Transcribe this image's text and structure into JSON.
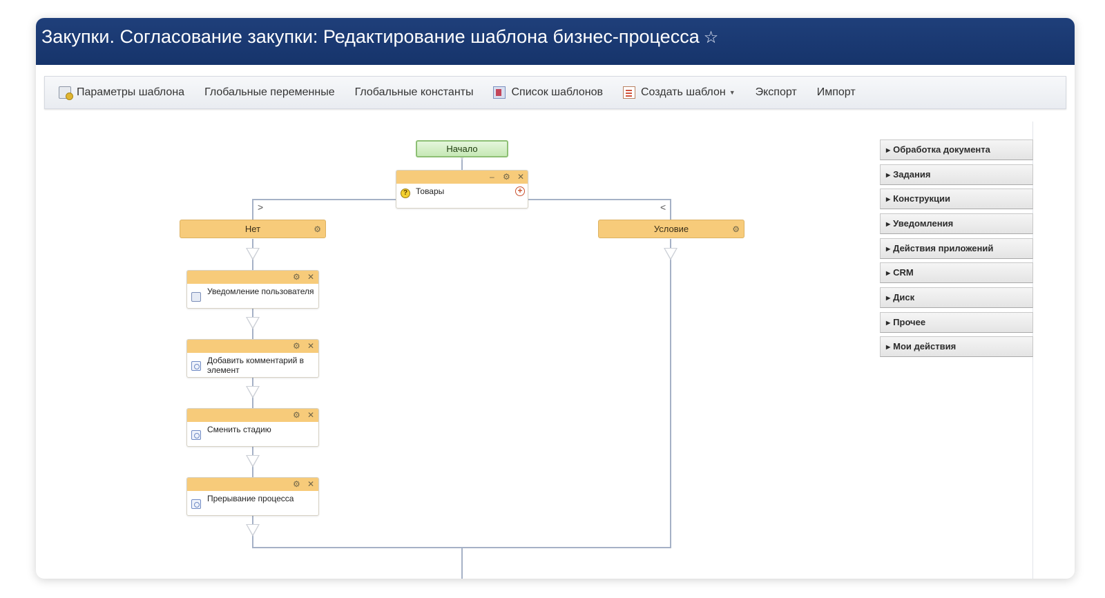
{
  "header": {
    "title": "Закупки. Согласование закупки: Редактирование шаблона бизнес-процесса",
    "star": "☆"
  },
  "toolbar": {
    "items": [
      {
        "label": "Параметры шаблона",
        "icon": "template-params-icon"
      },
      {
        "label": "Глобальные переменные"
      },
      {
        "label": "Глобальные константы"
      },
      {
        "label": "Список шаблонов",
        "icon": "template-list-icon"
      },
      {
        "label": "Создать шаблон",
        "icon": "create-template-icon",
        "dropdown": true
      },
      {
        "label": "Экспорт"
      },
      {
        "label": "Импорт"
      }
    ]
  },
  "diagram": {
    "start_label": "Начало",
    "condition_block": {
      "label": "Товары",
      "icon": "condition-icon"
    },
    "branches": [
      {
        "label": "Нет",
        "chevron": ">"
      },
      {
        "label": "Условие",
        "chevron": "<"
      }
    ],
    "actions": [
      {
        "label": "Уведомление пользователя",
        "icon": "notification-icon"
      },
      {
        "label": "Добавить комментарий в элемент",
        "icon": "activity-icon"
      },
      {
        "label": "Сменить стадию",
        "icon": "activity-icon"
      },
      {
        "label": "Прерывание процесса",
        "icon": "activity-icon"
      }
    ],
    "header_icons": {
      "minimize": "–",
      "settings": "⚙",
      "close": "✕",
      "add": "+"
    }
  },
  "palette": {
    "arrow": "▶",
    "items": [
      "Обработка документа",
      "Задания",
      "Конструкции",
      "Уведомления",
      "Действия приложений",
      "CRM",
      "Диск",
      "Прочее",
      "Мои действия"
    ]
  },
  "colors": {
    "title_bar": "#1f3f7a",
    "block_header": "#f7cb7a",
    "start_block": "#c6e8b5",
    "connector": "#a5b1c6"
  }
}
